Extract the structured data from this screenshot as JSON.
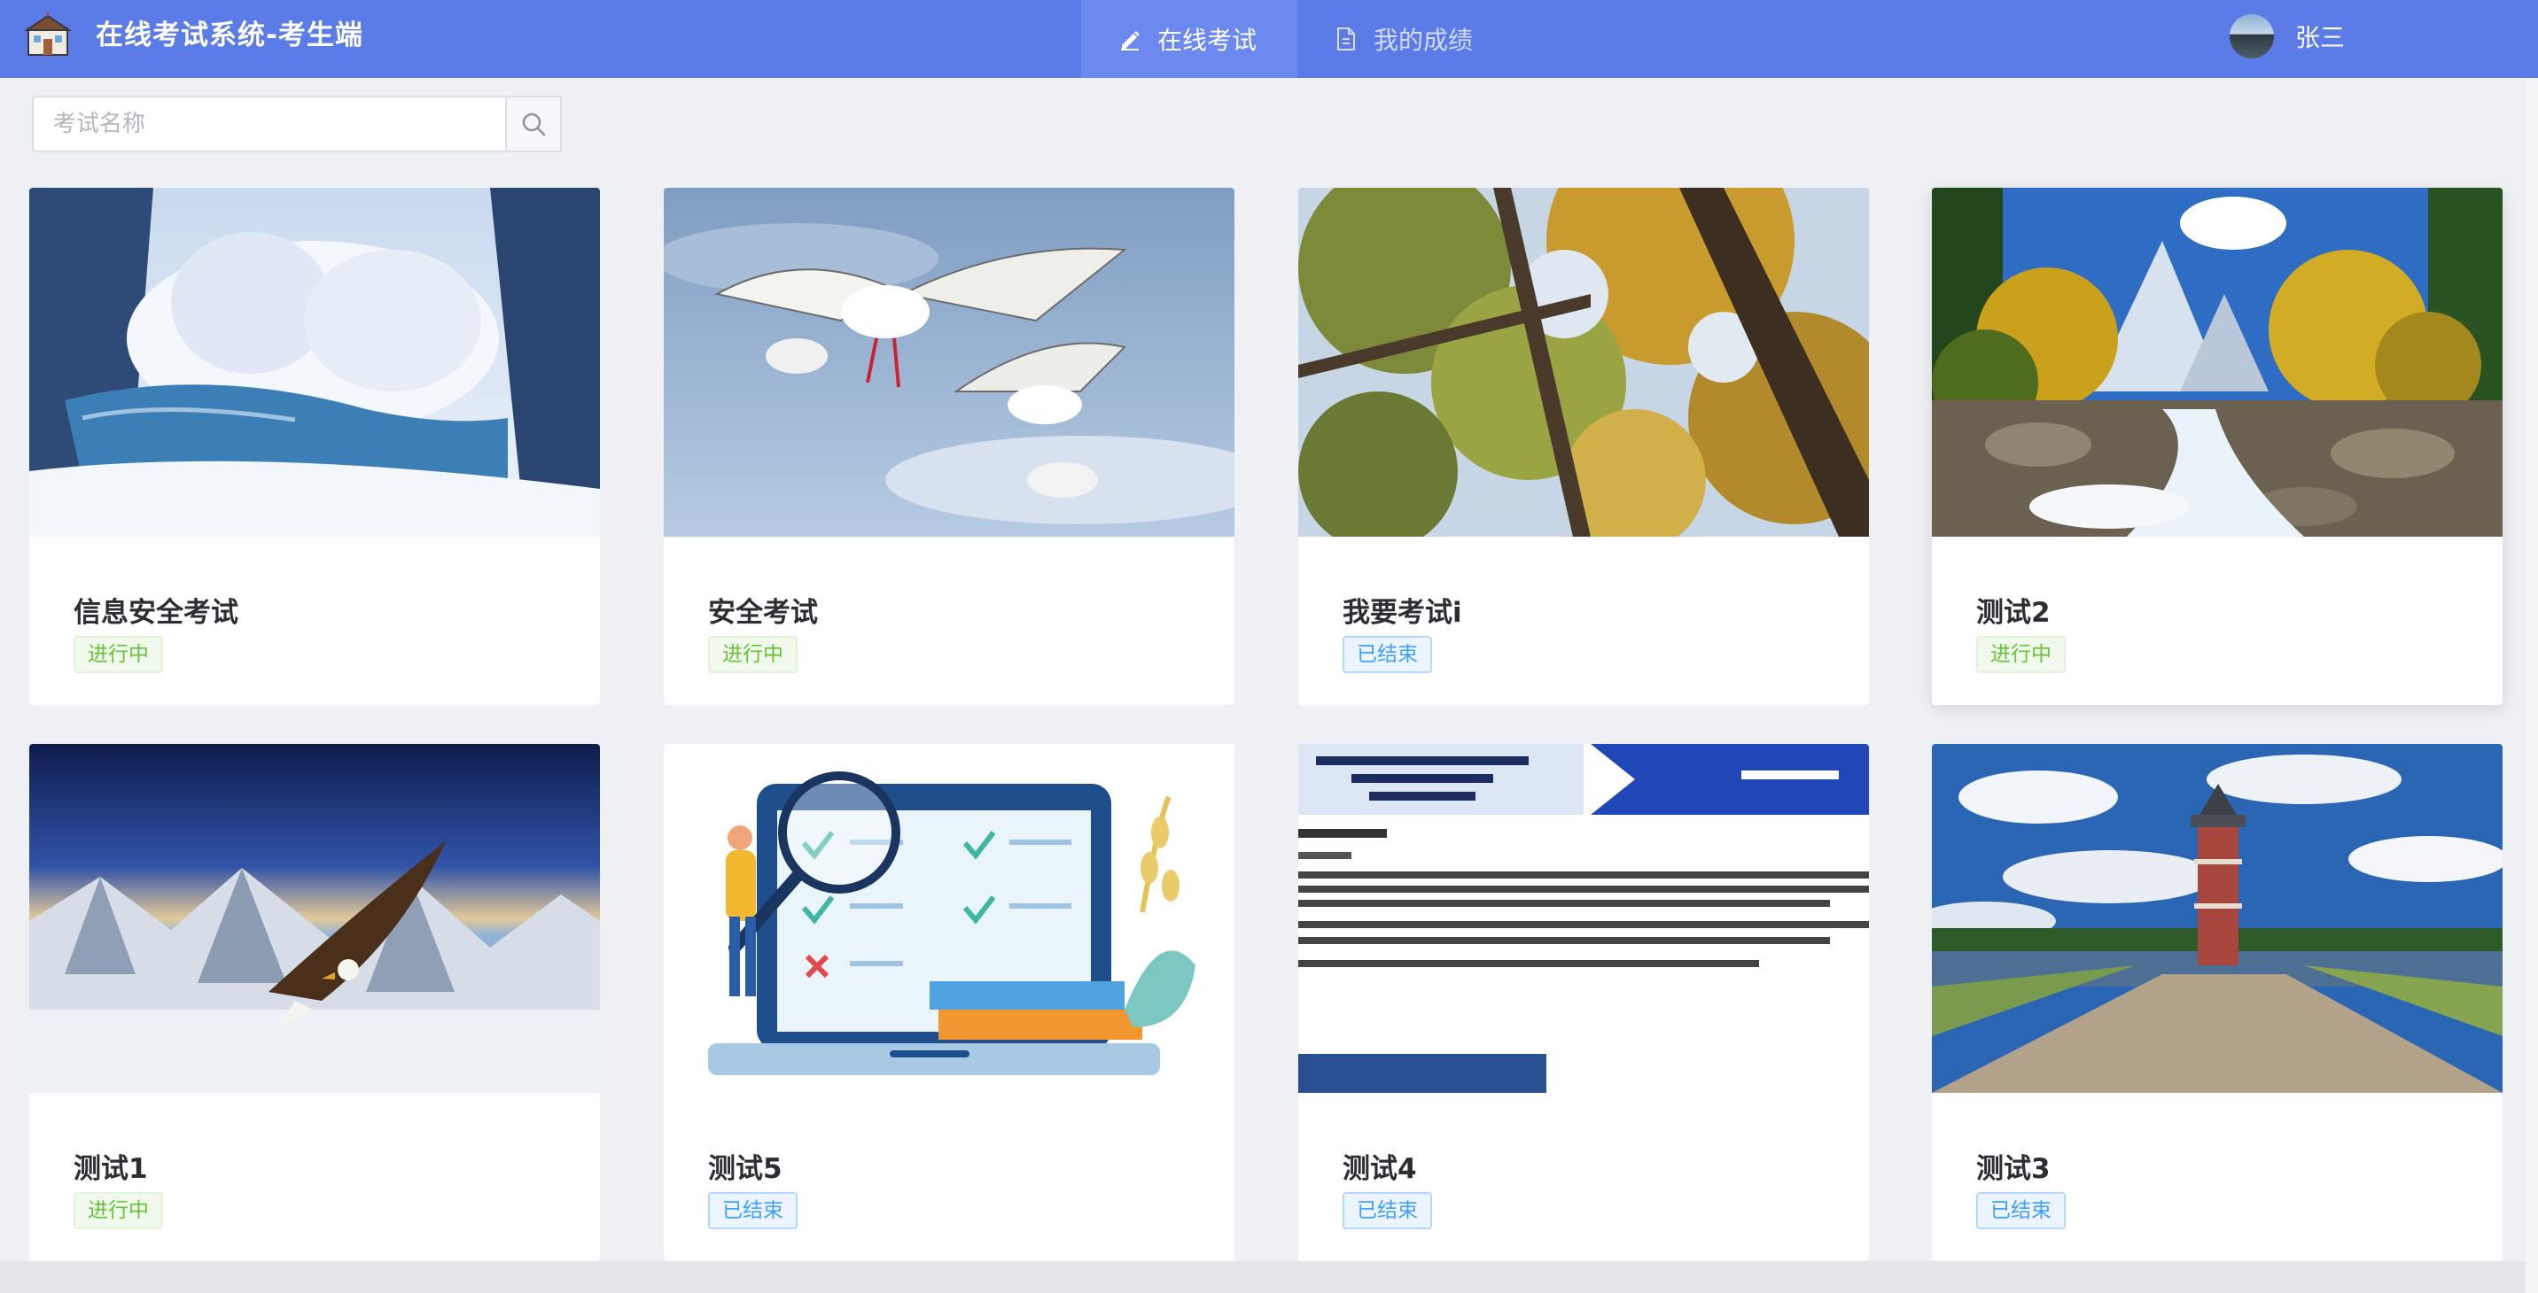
{
  "header": {
    "app_title": "在线考试系统-考生端",
    "nav": [
      {
        "label": "在线考试",
        "icon": "edit-icon",
        "active": true
      },
      {
        "label": "我的成绩",
        "icon": "document-icon",
        "active": false
      }
    ],
    "user_name": "张三",
    "colors": {
      "bar": "#5b7be7",
      "active_tab": "#6b89ee"
    }
  },
  "search": {
    "placeholder": "考试名称",
    "value": "",
    "icon": "search-icon"
  },
  "status_colors": {
    "进行中": "#67c23a",
    "已结束": "#409eff"
  },
  "exams": [
    {
      "title": "信息安全考试",
      "status": "进行中",
      "image": "snowy-river-forest"
    },
    {
      "title": "安全考试",
      "status": "进行中",
      "image": "flying-seagulls"
    },
    {
      "title": "我要考试i",
      "status": "已结束",
      "image": "autumn-trees-canopy"
    },
    {
      "title": "测试2",
      "status": "进行中",
      "image": "mountain-stream"
    },
    {
      "title": "测试1",
      "status": "进行中",
      "image": "eagle-snow-mountains"
    },
    {
      "title": "测试5",
      "status": "已结束",
      "image": "exam-checklist-illustration"
    },
    {
      "title": "测试4",
      "status": "已结束",
      "image": "exam-document"
    },
    {
      "title": "测试3",
      "status": "已结束",
      "image": "lighthouse-path"
    }
  ]
}
